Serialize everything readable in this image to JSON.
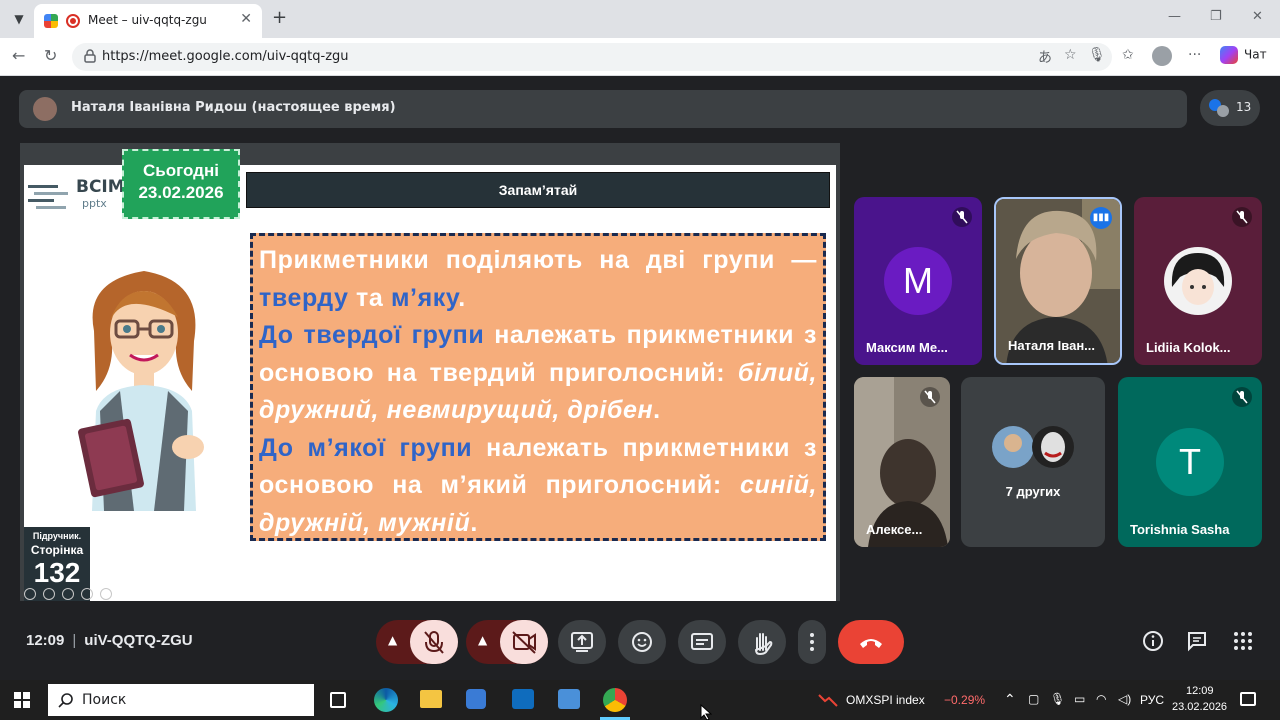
{
  "browser": {
    "tab_title": "Meet – uiv-qqtq-zgu",
    "url": "https://meet.google.com/uiv-qqtq-zgu",
    "chat_label": "Чат"
  },
  "meet": {
    "presenter_name": "Наталя Іванівна Ридош (настоящее время)",
    "participant_count": "13",
    "time": "12:09",
    "meeting_code": "uiV-QQTQ-ZGU"
  },
  "slide": {
    "logo_text": "ВСІМ",
    "logo_sub": "pptx",
    "today_label": "Сьогодні",
    "today_date": "23.02.2026",
    "remember_title": "Запам’ятай",
    "rule": {
      "p1a": "Прикметники поділяють на дві групи —",
      "p1b_blue1": "тверду",
      "p1b_mid": " та ",
      "p1b_blue2": "м’яку",
      "p1b_end": ".",
      "p2_blue": "До твердої групи",
      "p2_rest": " належать прикметники з основою на твердий приголосний: ",
      "p2_examples": "білий, дружний, невмирущий, дрібен",
      "p2_end": ".",
      "p3_blue": "До м’якої групи",
      "p3_rest": " належать прикметники з основою на м’який приголосний: ",
      "p3_examples": "синій, дружній, мужній",
      "p3_end": "."
    },
    "page_label_1": "Підручник.",
    "page_label_2": "Сторінка",
    "page_number": "132"
  },
  "tiles": [
    {
      "name": "Максим Ме...",
      "initial": "М",
      "bg": "#4a148c",
      "avatar_bg": "#6a1bc2"
    },
    {
      "name": "Наталя Іван..."
    },
    {
      "name": "Lidiia Kolok...",
      "bg": "#5a1e3a"
    },
    {
      "name": "Алексе..."
    },
    {
      "name": "7 других"
    },
    {
      "name": "Torishnia Sasha",
      "initial": "T",
      "bg": "#00695c",
      "avatar_bg": "#00897b"
    }
  ],
  "taskbar": {
    "search_placeholder": "Поиск",
    "stock_name": "OMXSPI index",
    "stock_change": "−0.29%",
    "lang": "РУС",
    "time": "12:09",
    "date": "23.02.2026"
  },
  "colors": {
    "end_call": "#ea4335",
    "slide_orange": "#f6ad7b",
    "slide_blue_text": "#2f64c8",
    "today_green": "#21a35a"
  }
}
